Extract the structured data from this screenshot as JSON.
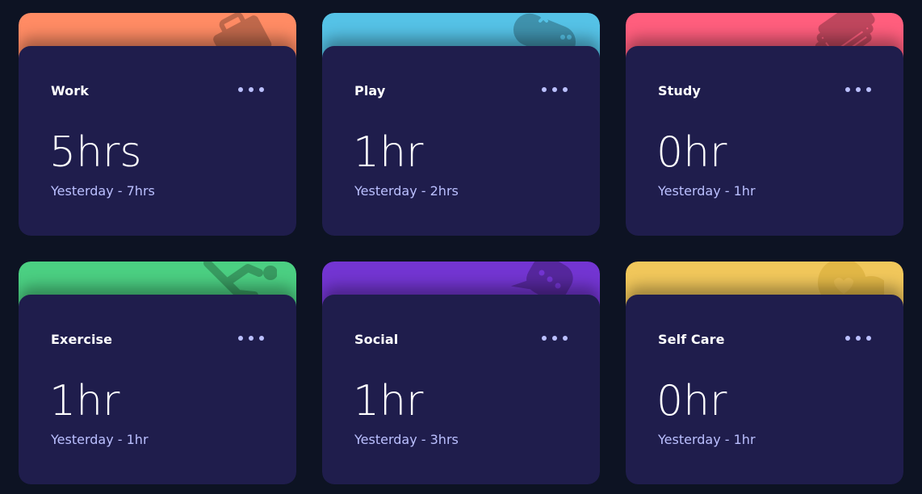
{
  "cards": [
    {
      "title": "Work",
      "hours": "5hrs",
      "previous": "Yesterday - 7hrs",
      "accent": "#ff8b64",
      "icon": "briefcase-icon"
    },
    {
      "title": "Play",
      "hours": "1hr",
      "previous": "Yesterday - 2hrs",
      "accent": "#55c2e6",
      "icon": "gamepad-icon"
    },
    {
      "title": "Study",
      "hours": "0hr",
      "previous": "Yesterday - 1hr",
      "accent": "#ff5e7d",
      "icon": "books-icon"
    },
    {
      "title": "Exercise",
      "hours": "1hr",
      "previous": "Yesterday - 1hr",
      "accent": "#4bcf82",
      "icon": "running-icon"
    },
    {
      "title": "Social",
      "hours": "1hr",
      "previous": "Yesterday - 3hrs",
      "accent": "#7335d2",
      "icon": "chat-bubble-icon"
    },
    {
      "title": "Self Care",
      "hours": "0hr",
      "previous": "Yesterday - 1hr",
      "accent": "#f1c75b",
      "icon": "heart-icon"
    }
  ]
}
